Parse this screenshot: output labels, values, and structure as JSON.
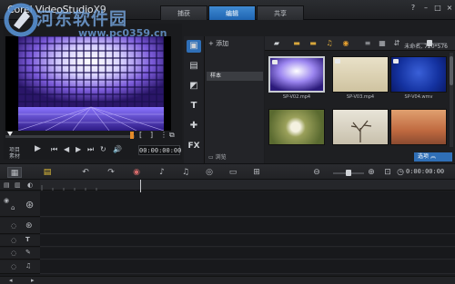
{
  "app": {
    "title": "Corel VideoStudio",
    "version": "X9"
  },
  "mode_tabs": [
    {
      "label": "捕获",
      "active": false
    },
    {
      "label": "编辑",
      "active": true
    },
    {
      "label": "共享",
      "active": false
    }
  ],
  "window_controls": {
    "help": "?",
    "minimize": "–",
    "maximize": "□",
    "close": "×"
  },
  "watermark": {
    "text": "河东软件园",
    "url": "www.pc0359.cn"
  },
  "player": {
    "project_label": "项目",
    "clip_label": "素材",
    "timecode": "00:00:00:00",
    "scrub_position": 0.0,
    "brackets": [
      "[",
      "]"
    ]
  },
  "library": {
    "add_label": "添加",
    "folder": "样本",
    "browse_label": "浏览",
    "options_label": "选项",
    "project_info": "未命名, 720*576",
    "thumbnails": [
      {
        "caption": "SP-V02.mp4",
        "selected": true
      },
      {
        "caption": "SP-V03.mp4",
        "selected": false
      },
      {
        "caption": "SP-V04.wmv",
        "selected": false
      },
      {
        "caption": "",
        "selected": false
      },
      {
        "caption": "",
        "selected": false
      },
      {
        "caption": "",
        "selected": false
      }
    ]
  },
  "timeline": {
    "timecode": "0:00:00:00"
  },
  "colors": {
    "accent": "#2f6fb7",
    "scrub_marker": "#e38a2a",
    "background": "#1c1d20"
  }
}
